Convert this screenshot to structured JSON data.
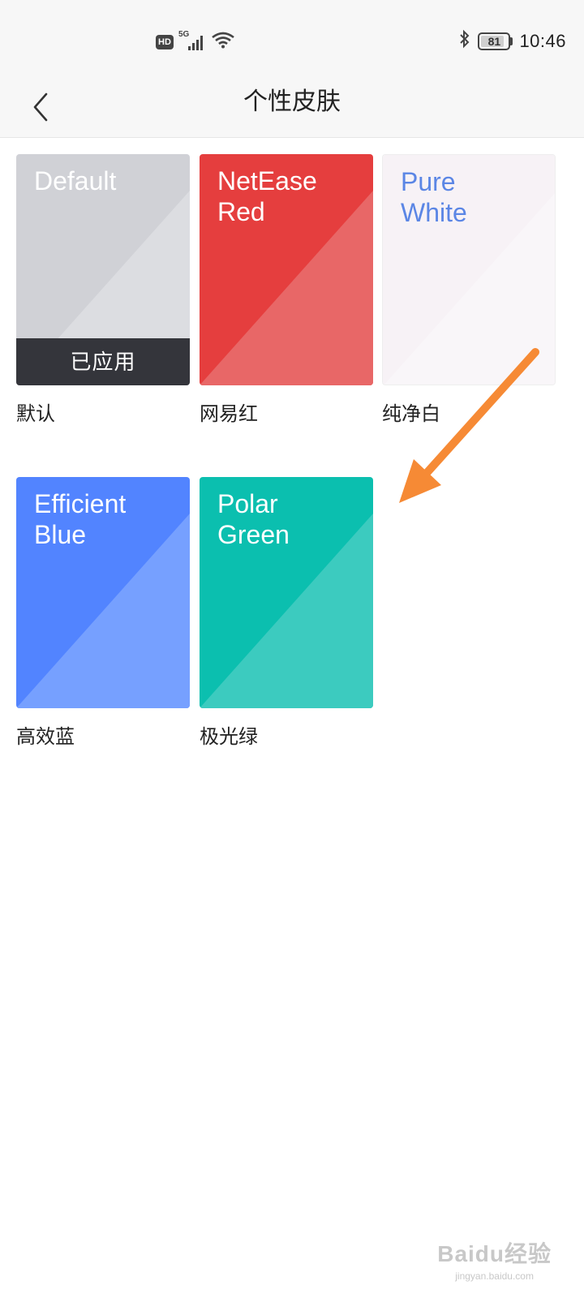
{
  "status_bar": {
    "hd_badge": "HD",
    "network": "5G",
    "battery": "81",
    "time": "10:46"
  },
  "nav": {
    "title": "个性皮肤"
  },
  "skins": [
    {
      "card_title": "Default",
      "label": "默认",
      "applied_text": "已应用",
      "color": "#d0d1d6",
      "overlay": "#dcdde1",
      "title_color": "#ffffff"
    },
    {
      "card_title": "NetEase\nRed",
      "label": "网易红",
      "color": "#e53e3e",
      "overlay": "#e86767",
      "title_color": "#ffffff"
    },
    {
      "card_title": "Pure\nWhite",
      "label": "纯净白",
      "color": "#f7f2f6",
      "overlay": "#f9f6f9",
      "title_color": "#5b86e5"
    },
    {
      "card_title": "Efficient\nBlue",
      "label": "高效蓝",
      "color": "#5284ff",
      "overlay": "#76a0ff",
      "title_color": "#ffffff"
    },
    {
      "card_title": "Polar\nGreen",
      "label": "极光绿",
      "color": "#0bbfaf",
      "overlay": "#3ccbbf",
      "title_color": "#ffffff"
    }
  ],
  "colors": {
    "arrow": "#f68a35"
  },
  "watermark": {
    "logo": "Baidu经验",
    "url": "jingyan.baidu.com"
  }
}
